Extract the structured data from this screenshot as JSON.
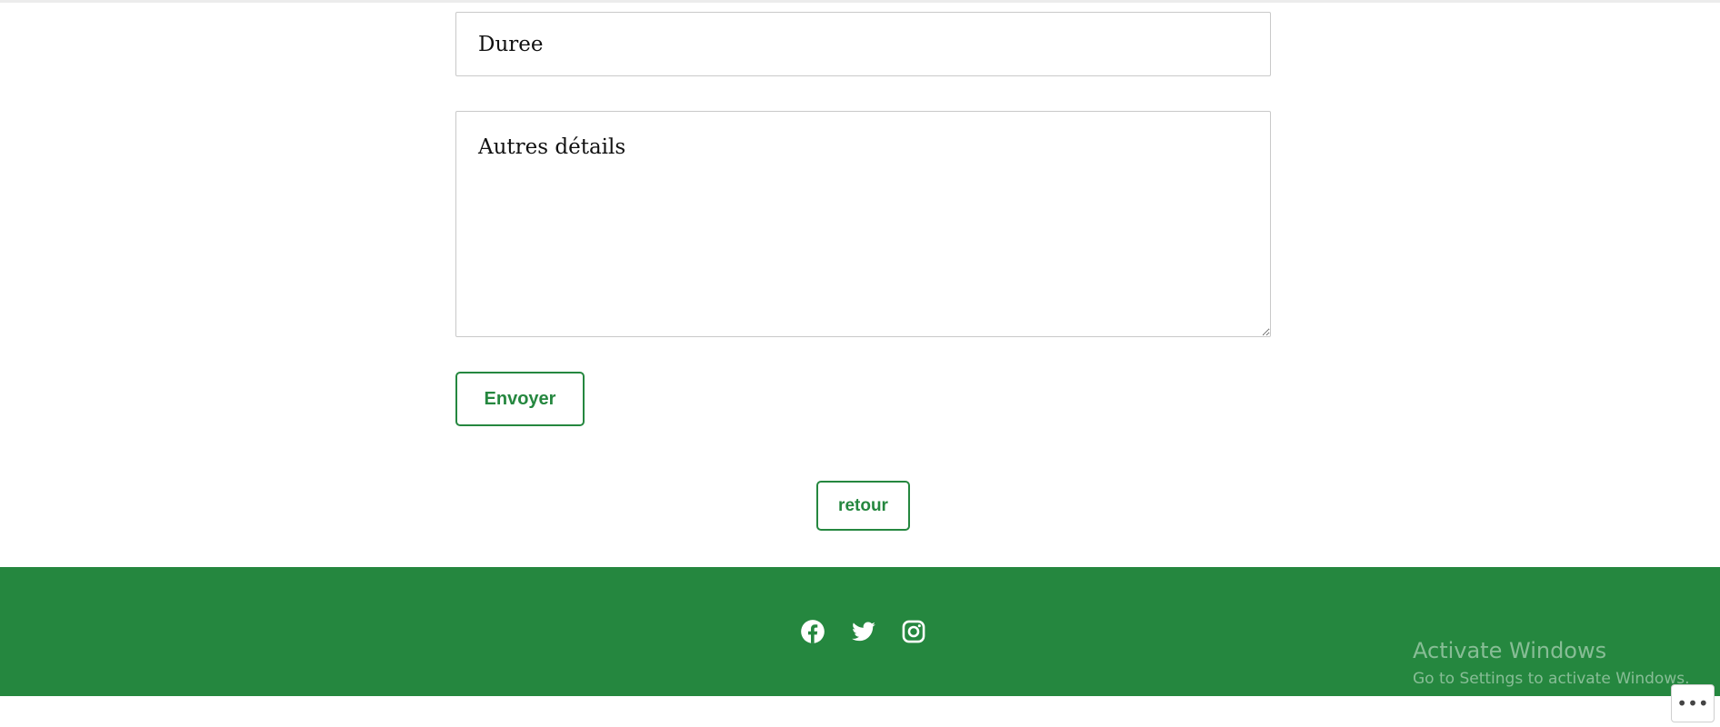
{
  "form": {
    "duration_placeholder": "Duree",
    "details_placeholder": "Autres détails",
    "submit_label": "Envoyer"
  },
  "navigation": {
    "back_label": "retour"
  },
  "footer": {
    "social_icons": [
      "facebook-icon",
      "twitter-icon",
      "instagram-icon"
    ]
  },
  "watermark": {
    "title": "Activate Windows",
    "subtitle": "Go to Settings to activate Windows."
  },
  "overlay": {
    "more_label": "•••"
  },
  "colors": {
    "accent": "#25873f",
    "footer_background": "#25873f",
    "page_background": "#ffffff"
  }
}
